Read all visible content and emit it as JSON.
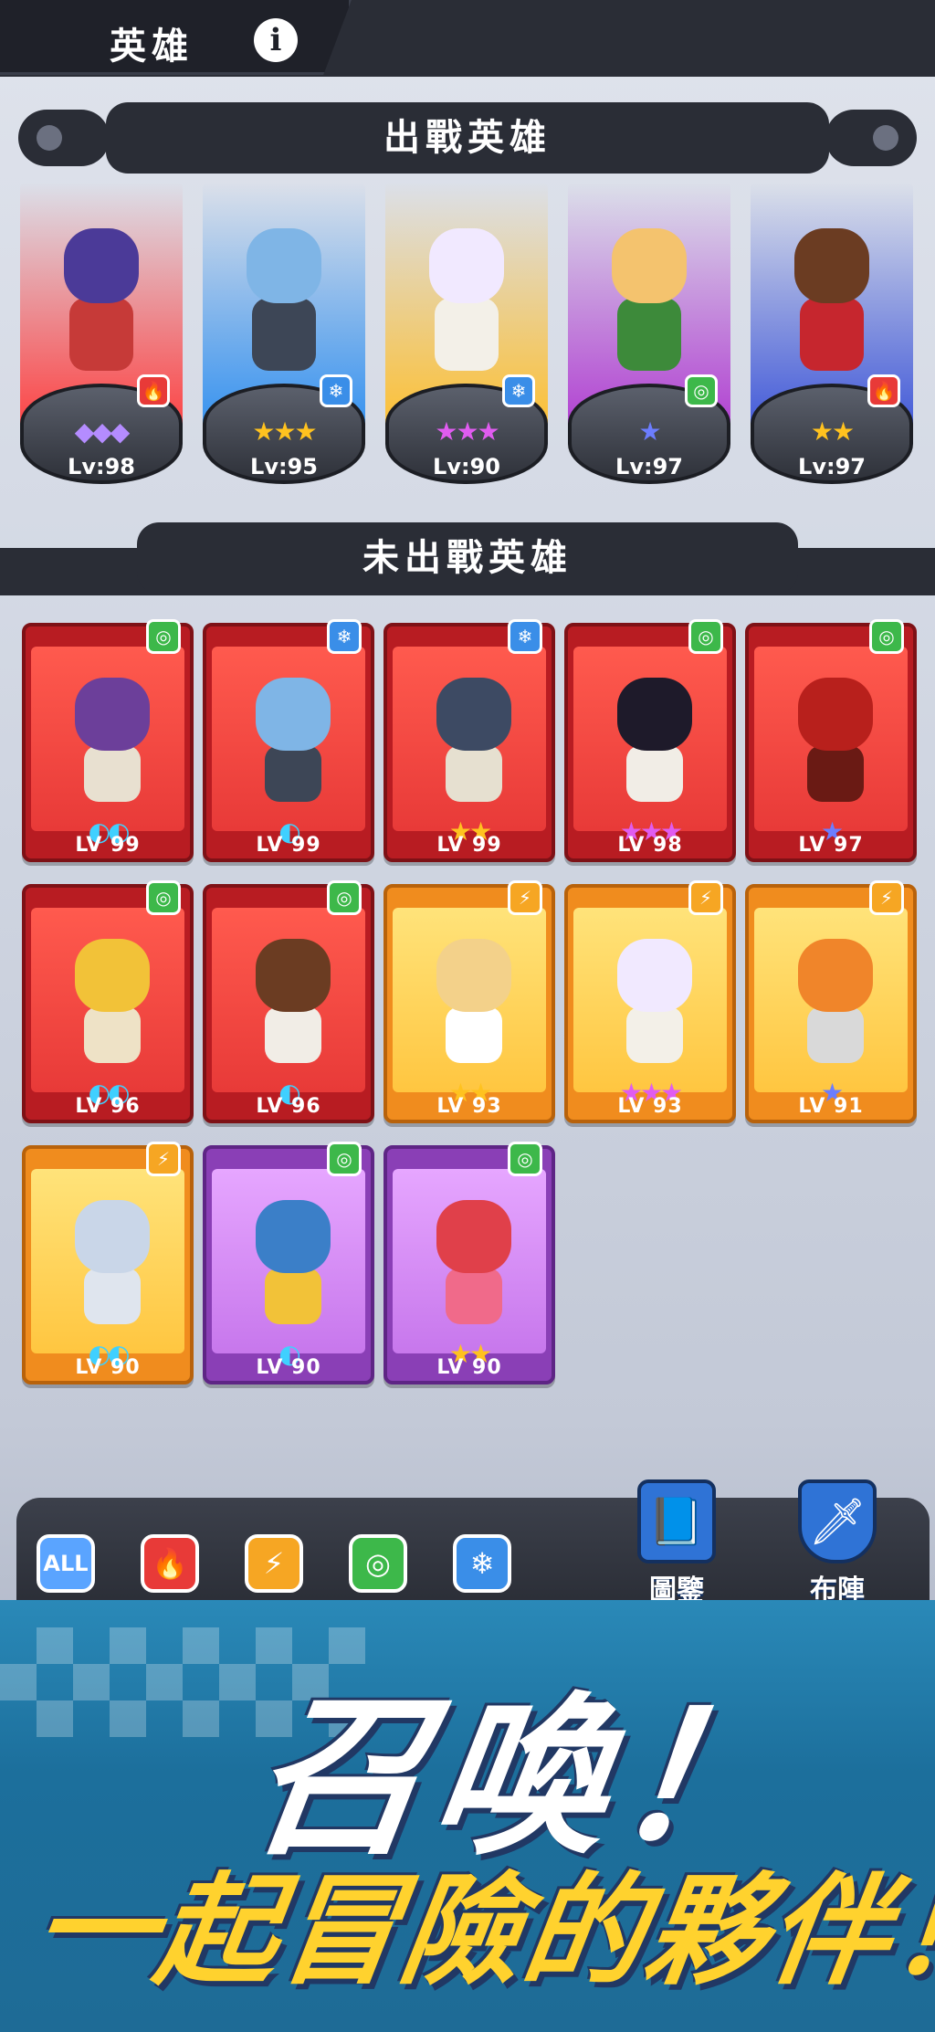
{
  "header": {
    "title": "英雄",
    "info_icon": "info-icon"
  },
  "sections": {
    "deployed_title": "出戰英雄",
    "reserve_title": "未出戰英雄"
  },
  "deployed": [
    {
      "lv": "Lv:98",
      "stars": "◆◆◆",
      "star_color": "#b48cff",
      "element": "fire",
      "element_glyph": "🔥",
      "beam": "#ff3d3d",
      "head": "#4b3a98",
      "body": "#c63a38"
    },
    {
      "lv": "Lv:95",
      "stars": "★★★",
      "star_color": "#ffc21f",
      "element": "ice",
      "element_glyph": "❄",
      "beam": "#2f8ff0",
      "head": "#7fb5e6",
      "body": "#3d4656"
    },
    {
      "lv": "Lv:90",
      "stars": "★★★",
      "star_color": "#e05cf0",
      "element": "ice",
      "element_glyph": "❄",
      "beam": "#ffbf2c",
      "head": "#f1e9ff",
      "body": "#f3f0e8"
    },
    {
      "lv": "Lv:97",
      "stars": "★",
      "star_color": "#6c7dff",
      "element": "wind",
      "element_glyph": "◎",
      "beam": "#b03ad1",
      "head": "#f4c36e",
      "body": "#3d8a3a"
    },
    {
      "lv": "Lv:97",
      "stars": "★★",
      "star_color": "#ffc21f",
      "element": "fire",
      "element_glyph": "🔥",
      "beam": "#3d55d8",
      "head": "#6b3c22",
      "body": "#c6262e"
    }
  ],
  "reserve": [
    {
      "lv": "LV 99",
      "stars": "◐◐",
      "star_color": "#3fd0ff",
      "element": "wind",
      "element_glyph": "◎",
      "theme": "red",
      "head": "#6c3f9a",
      "body": "#e8e0d0"
    },
    {
      "lv": "LV 99",
      "stars": "◐",
      "star_color": "#3fd0ff",
      "element": "ice",
      "element_glyph": "❄",
      "theme": "red",
      "head": "#7fb5e6",
      "body": "#3d4656"
    },
    {
      "lv": "LV 99",
      "stars": "★★",
      "star_color": "#ffc21f",
      "element": "ice",
      "element_glyph": "❄",
      "theme": "red",
      "head": "#3d4a63",
      "body": "#e6e0d0"
    },
    {
      "lv": "LV 98",
      "stars": "★★★",
      "star_color": "#e05cf0",
      "element": "wind",
      "element_glyph": "◎",
      "theme": "red",
      "head": "#1e1a2a",
      "body": "#f1ede6"
    },
    {
      "lv": "LV 97",
      "stars": "★",
      "star_color": "#6c7dff",
      "element": "wind",
      "element_glyph": "◎",
      "theme": "red",
      "head": "#b8201c",
      "body": "#6a1a14"
    },
    {
      "lv": "LV 96",
      "stars": "◐◐",
      "star_color": "#3fd0ff",
      "element": "wind",
      "element_glyph": "◎",
      "theme": "red",
      "head": "#f2c238",
      "body": "#eee2c6"
    },
    {
      "lv": "LV 96",
      "stars": "◐",
      "star_color": "#3fd0ff",
      "element": "wind",
      "element_glyph": "◎",
      "theme": "red",
      "head": "#6b3c22",
      "body": "#f1ede6"
    },
    {
      "lv": "LV 93",
      "stars": "★★",
      "star_color": "#ffc21f",
      "element": "bolt",
      "element_glyph": "⚡",
      "theme": "orange",
      "head": "#f3d18a",
      "body": "#ffffff"
    },
    {
      "lv": "LV 93",
      "stars": "★★★",
      "star_color": "#e05cf0",
      "element": "bolt",
      "element_glyph": "⚡",
      "theme": "orange",
      "head": "#f1e9ff",
      "body": "#f3f0e8"
    },
    {
      "lv": "LV 91",
      "stars": "★",
      "star_color": "#6c7dff",
      "element": "bolt",
      "element_glyph": "⚡",
      "theme": "orange",
      "head": "#f0852a",
      "body": "#d9d9d9"
    },
    {
      "lv": "LV 90",
      "stars": "◐◐",
      "star_color": "#3fd0ff",
      "element": "bolt",
      "element_glyph": "⚡",
      "theme": "orange",
      "head": "#c9d6e8",
      "body": "#dfe5ee"
    },
    {
      "lv": "LV 90",
      "stars": "◐",
      "star_color": "#3fd0ff",
      "element": "wind",
      "element_glyph": "◎",
      "theme": "purple",
      "head": "#3b7fc8",
      "body": "#f2c238"
    },
    {
      "lv": "LV 90",
      "stars": "★★",
      "star_color": "#ffc21f",
      "element": "wind",
      "element_glyph": "◎",
      "theme": "purple",
      "head": "#e0404a",
      "body": "#f06a8a"
    }
  ],
  "filters": [
    {
      "name": "filter-all-button",
      "label": "ALL",
      "cls": "all",
      "color": "#5aa4ff"
    },
    {
      "name": "filter-fire-button",
      "label": "🔥",
      "cls": "",
      "color": "#e83a38"
    },
    {
      "name": "filter-bolt-button",
      "label": "⚡",
      "cls": "",
      "color": "#f6a623"
    },
    {
      "name": "filter-wind-button",
      "label": "◎",
      "cls": "",
      "color": "#3db84a"
    },
    {
      "name": "filter-ice-button",
      "label": "❄",
      "cls": "",
      "color": "#3a8ee8"
    }
  ],
  "buttons": {
    "codex_label": "圖鑒",
    "codex_icon": "book-icon",
    "formation_label": "布陣",
    "formation_icon": "shield-icon"
  },
  "promo": {
    "title": "召喚！",
    "subtitle": "一起冒險的夥伴！"
  },
  "colors": {
    "fire": "#e83a38",
    "ice": "#3a8ee8",
    "wind": "#3db84a",
    "bolt": "#f6a623"
  }
}
